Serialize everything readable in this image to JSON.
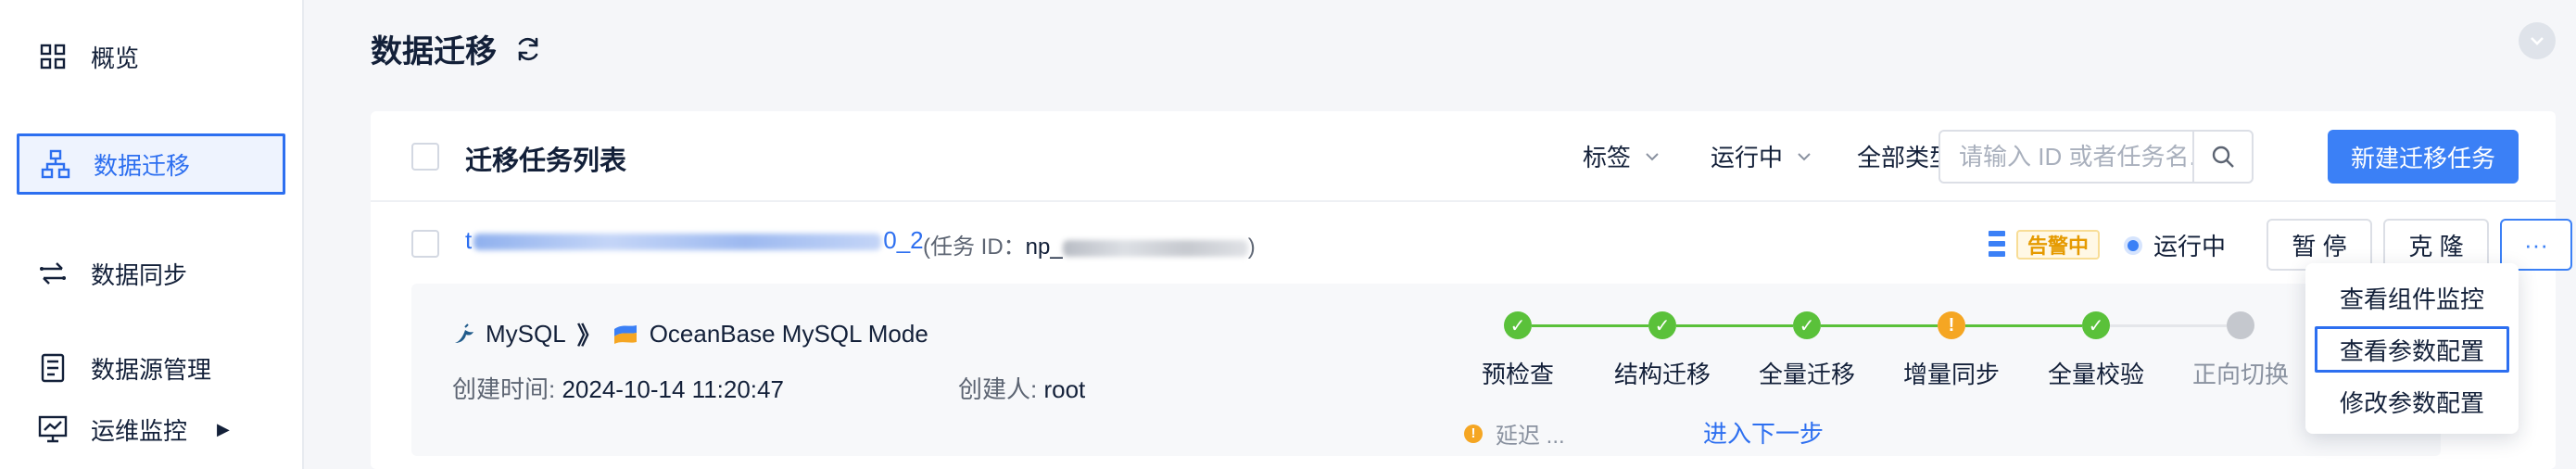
{
  "sidebar": {
    "items": [
      {
        "label": "概览",
        "icon": "grid-icon"
      },
      {
        "label": "数据迁移",
        "icon": "hierarchy-icon",
        "active": true
      },
      {
        "label": "数据同步",
        "icon": "sync-arrows-icon"
      },
      {
        "label": "数据源管理",
        "icon": "database-list-icon"
      },
      {
        "label": "运维监控",
        "icon": "monitor-chart-icon",
        "has_submenu": true
      }
    ]
  },
  "header": {
    "title": "数据迁移"
  },
  "toolbar": {
    "list_title": "迁移任务列表",
    "filters": {
      "tag": "标签",
      "status": "运行中",
      "type": "全部类型"
    },
    "search_placeholder": "请输入 ID 或者任务名...",
    "new_button": "新建迁移任务"
  },
  "task": {
    "name_prefix": "t",
    "name_suffix": "0_2",
    "id_label": "(任务 ID：",
    "id_prefix": "np_",
    "id_close": ")",
    "alert_badge": "告警中",
    "status": "运行中",
    "buttons": {
      "pause": "暂 停",
      "clone": "克 隆",
      "more": "···"
    },
    "source_db": "MySQL",
    "arrow": "》",
    "target_db": "OceanBase MySQL Mode",
    "created_time_label": "创建时间: ",
    "created_time": "2024-10-14 11:20:47",
    "creator_label": "创建人: ",
    "creator": "root",
    "steps": [
      {
        "label": "预检查",
        "state": "done"
      },
      {
        "label": "结构迁移",
        "state": "done"
      },
      {
        "label": "全量迁移",
        "state": "done"
      },
      {
        "label": "增量同步",
        "state": "warning"
      },
      {
        "label": "全量校验",
        "state": "done"
      },
      {
        "label": "正向切换",
        "state": "pending"
      }
    ],
    "delay_text": "延迟 ...",
    "next_step": "进入下一步"
  },
  "more_menu": {
    "items": [
      "查看组件监控",
      "查看参数配置",
      "修改参数配置"
    ]
  },
  "colors": {
    "accent": "#3b80f6",
    "success": "#5ac13a",
    "warning": "#f5a623",
    "pending": "#c5c8ce"
  }
}
